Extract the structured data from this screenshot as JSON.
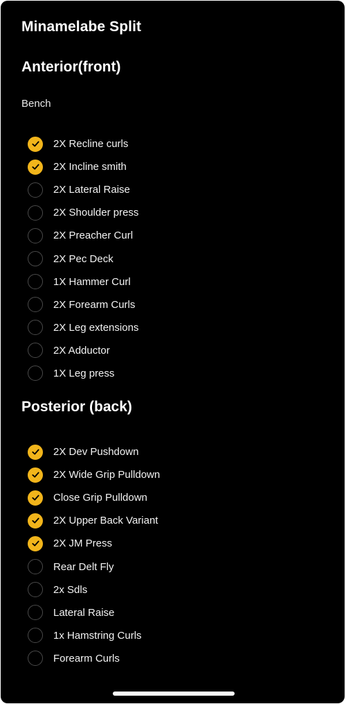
{
  "page": {
    "title": "Minamelabe Split"
  },
  "anterior": {
    "title": "Anterior(front)",
    "subtitle": "Bench",
    "items": [
      {
        "label": "2X Recline curls",
        "checked": true
      },
      {
        "label": "2X Incline smith",
        "checked": true
      },
      {
        "label": "2X Lateral Raise",
        "checked": false
      },
      {
        "label": "2X Shoulder press",
        "checked": false
      },
      {
        "label": "2X Preacher Curl",
        "checked": false
      },
      {
        "label": "2X Pec Deck",
        "checked": false
      },
      {
        "label": "1X Hammer Curl",
        "checked": false
      },
      {
        "label": "2X Forearm Curls",
        "checked": false
      },
      {
        "label": "2X Leg extensions",
        "checked": false
      },
      {
        "label": "2X Adductor",
        "checked": false
      },
      {
        "label": "1X Leg press",
        "checked": false
      }
    ]
  },
  "posterior": {
    "title": "Posterior (back)",
    "items": [
      {
        "label": "2X Dev Pushdown",
        "checked": true
      },
      {
        "label": "2X Wide Grip Pulldown",
        "checked": true
      },
      {
        "label": "Close Grip Pulldown",
        "checked": true
      },
      {
        "label": "2X Upper Back Variant",
        "checked": true
      },
      {
        "label": "2X JM Press",
        "checked": true
      },
      {
        "label": "Rear Delt Fly",
        "checked": false
      },
      {
        "label": "2x Sdls",
        "checked": false
      },
      {
        "label": "Lateral Raise",
        "checked": false
      },
      {
        "label": "1x Hamstring Curls",
        "checked": false
      },
      {
        "label": "Forearm Curls",
        "checked": false
      }
    ]
  },
  "theme": {
    "background": "#000000",
    "accent": "#f2b51b",
    "unchecked_border": "#4a4a4a",
    "text": "#f2f2f2",
    "checkmark_icon": "checkmark-icon"
  }
}
